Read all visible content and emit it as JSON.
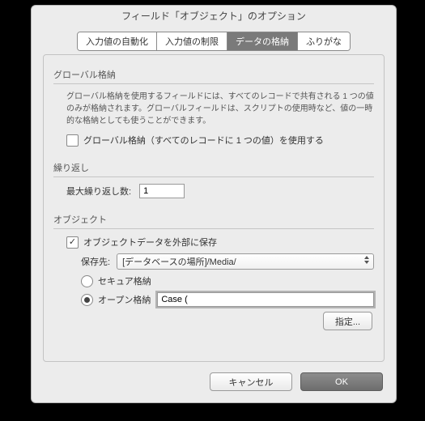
{
  "window": {
    "title": "フィールド「オブジェクト」のオプション"
  },
  "tabs": {
    "t0": "入力値の自動化",
    "t1": "入力値の制限",
    "t2": "データの格納",
    "t3": "ふりがな"
  },
  "global": {
    "heading": "グローバル格納",
    "desc": "グローバル格納を使用するフィールドには、すべてのレコードで共有される 1 つの値のみが格納されます。グローバルフィールドは、スクリプトの使用時など、値の一時的な格納としても使うことができます。",
    "checkbox": "グローバル格納（すべてのレコードに 1 つの値）を使用する"
  },
  "repeat": {
    "heading": "繰り返し",
    "label": "最大繰り返し数:",
    "value": "1"
  },
  "object": {
    "heading": "オブジェクト",
    "external": "オブジェクトデータを外部に保存",
    "location_label": "保存先:",
    "location_value": "[データベースの場所]/Media/",
    "secure": "セキュア格納",
    "open": "オープン格納",
    "open_value": "Case (",
    "specify": "指定..."
  },
  "footer": {
    "cancel": "キャンセル",
    "ok": "OK"
  }
}
